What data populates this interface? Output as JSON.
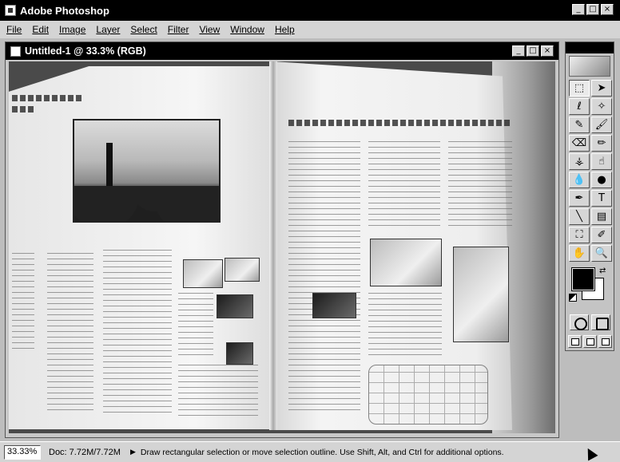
{
  "app": {
    "title": "Adobe Photoshop",
    "window_buttons": [
      "_",
      "□",
      "×"
    ]
  },
  "menu": [
    "File",
    "Edit",
    "Image",
    "Layer",
    "Select",
    "Filter",
    "View",
    "Window",
    "Help"
  ],
  "document": {
    "title": "Untitled-1 @ 33.3% (RGB)",
    "window_buttons": [
      "_",
      "□",
      "×"
    ]
  },
  "toolbox": {
    "tools": [
      {
        "name": "marquee-icon",
        "glyph": "⬚"
      },
      {
        "name": "move-icon",
        "glyph": "➤"
      },
      {
        "name": "lasso-icon",
        "glyph": "ℓ"
      },
      {
        "name": "magic-wand-icon",
        "glyph": "✧"
      },
      {
        "name": "airbrush-icon",
        "glyph": "✎"
      },
      {
        "name": "paintbrush-icon",
        "glyph": "🖌"
      },
      {
        "name": "eraser-icon",
        "glyph": "⌫"
      },
      {
        "name": "pencil-icon",
        "glyph": "✏"
      },
      {
        "name": "rubber-stamp-icon",
        "glyph": "⚶"
      },
      {
        "name": "smudge-icon",
        "glyph": "☝"
      },
      {
        "name": "blur-icon",
        "glyph": "💧"
      },
      {
        "name": "dodge-icon",
        "glyph": "●"
      },
      {
        "name": "pen-icon",
        "glyph": "✒"
      },
      {
        "name": "type-icon",
        "glyph": "T"
      },
      {
        "name": "line-icon",
        "glyph": "╲"
      },
      {
        "name": "gradient-icon",
        "glyph": "▤"
      },
      {
        "name": "paint-bucket-icon",
        "glyph": "⛶"
      },
      {
        "name": "eyedropper-icon",
        "glyph": "✐"
      },
      {
        "name": "hand-icon",
        "glyph": "✋"
      },
      {
        "name": "zoom-icon",
        "glyph": "🔍"
      }
    ],
    "foreground_color": "#000000",
    "background_color": "#ffffff"
  },
  "status": {
    "zoom": "33.33%",
    "doc_size": "Doc: 7.72M/7.72M",
    "message": "Draw rectangular selection or move selection outline.  Use Shift, Alt, and Ctrl for additional options."
  }
}
